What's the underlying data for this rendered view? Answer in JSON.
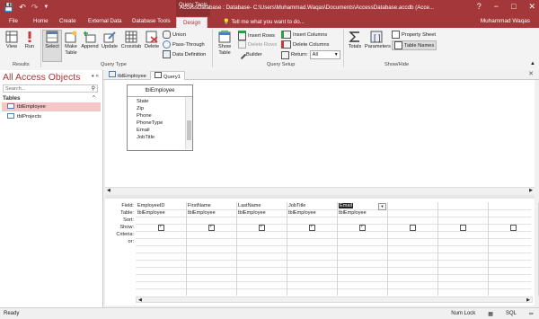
{
  "titlebar": {
    "title": "AccessDatabase : Database- C:\\Users\\Muhammad.Waqas\\Documents\\AccessDatabase.accdb (Acce...",
    "contextual_tab_group": "Query Tools",
    "minimize": "−",
    "restore": "□",
    "close": "✕",
    "help": "?"
  },
  "tabs": [
    "File",
    "Home",
    "Create",
    "External Data",
    "Database Tools",
    "Design"
  ],
  "tellme": "Tell me what you want to do...",
  "user": "Muhammad Waqas",
  "ribbon": {
    "results": {
      "label": "Results",
      "view": "View",
      "run": "Run"
    },
    "query_type": {
      "label": "Query Type",
      "select": "Select",
      "make_table": "Make Table",
      "append": "Append",
      "update": "Update",
      "crosstab": "Crosstab",
      "delete": "Delete",
      "union": "Union",
      "pass_through": "Pass-Through",
      "data_definition": "Data Definition"
    },
    "query_setup": {
      "label": "Query Setup",
      "show_table": "Show Table",
      "insert_rows": "Insert Rows",
      "delete_rows": "Delete Rows",
      "builder": "Builder",
      "insert_columns": "Insert Columns",
      "delete_columns": "Delete Columns",
      "return_label": "Return:",
      "return_value": "All"
    },
    "show_hide": {
      "label": "Show/Hide",
      "totals": "Totals",
      "parameters": "Parameters",
      "property_sheet": "Property Sheet",
      "table_names": "Table Names"
    }
  },
  "nav": {
    "title": "All Access Objects",
    "search_placeholder": "Search...",
    "section": "Tables",
    "items": [
      "tblEmployee",
      "tblProjects"
    ]
  },
  "doc_tabs": [
    "tblEmployee",
    "Query1"
  ],
  "field_list": {
    "title": "tblEmployee",
    "fields": [
      "State",
      "Zip",
      "Phone",
      "PhoneType",
      "Email",
      "JobTitle"
    ]
  },
  "grid": {
    "row_labels": [
      "Field:",
      "Table:",
      "Sort:",
      "Show:",
      "Criteria:",
      "or:"
    ],
    "columns": [
      {
        "field": "EmployeeID",
        "table": "tblEmployee",
        "show": true
      },
      {
        "field": "FirstName",
        "table": "tblEmployee",
        "show": true
      },
      {
        "field": "LastName",
        "table": "tblEmployee",
        "show": true
      },
      {
        "field": "JobTitle",
        "table": "tblEmployee",
        "show": true
      },
      {
        "field": "Email",
        "table": "tblEmployee",
        "show": true
      },
      {
        "field": "",
        "table": "",
        "show": false
      },
      {
        "field": "",
        "table": "",
        "show": false
      },
      {
        "field": "",
        "table": "",
        "show": false
      }
    ]
  },
  "status": {
    "left": "Ready",
    "num_lock": "Num Lock",
    "sql": "SQL"
  }
}
